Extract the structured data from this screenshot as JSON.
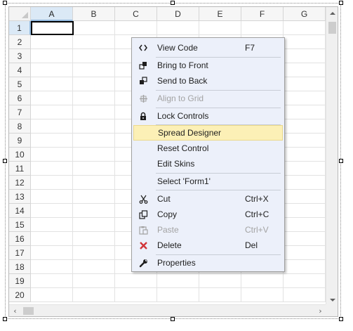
{
  "sheet": {
    "columns": [
      "A",
      "B",
      "C",
      "D",
      "E",
      "F",
      "G"
    ],
    "rows": [
      "1",
      "2",
      "3",
      "4",
      "5",
      "6",
      "7",
      "8",
      "9",
      "10",
      "11",
      "12",
      "13",
      "14",
      "15",
      "16",
      "17",
      "18",
      "19",
      "20"
    ],
    "active_column": "A",
    "active_row": "1"
  },
  "context_menu": {
    "view_code": {
      "label": "View Code",
      "shortcut": "F7",
      "icon": "code-brackets-icon"
    },
    "bring_to_front": {
      "label": "Bring to Front",
      "icon": "bring-to-front-icon"
    },
    "send_to_back": {
      "label": "Send to Back",
      "icon": "send-to-back-icon"
    },
    "align_to_grid": {
      "label": "Align to Grid",
      "icon": "align-grid-icon",
      "enabled": false
    },
    "lock_controls": {
      "label": "Lock Controls",
      "icon": "lock-icon"
    },
    "spread_designer": {
      "label": "Spread Designer",
      "highlighted": true
    },
    "reset_control": {
      "label": "Reset Control"
    },
    "edit_skins": {
      "label": "Edit Skins"
    },
    "select_form": {
      "label": "Select 'Form1'"
    },
    "cut": {
      "label": "Cut",
      "shortcut": "Ctrl+X",
      "icon": "scissors-icon"
    },
    "copy": {
      "label": "Copy",
      "shortcut": "Ctrl+C",
      "icon": "copy-icon"
    },
    "paste": {
      "label": "Paste",
      "shortcut": "Ctrl+V",
      "icon": "paste-icon",
      "enabled": false
    },
    "delete": {
      "label": "Delete",
      "shortcut": "Del",
      "icon": "delete-x-icon"
    },
    "properties": {
      "label": "Properties",
      "icon": "wrench-icon"
    }
  },
  "colors": {
    "menu_background": "#ecf0fa",
    "menu_highlight": "#fcf0b6",
    "delete_icon": "#d13438",
    "header_active": "#dbe9f6"
  }
}
